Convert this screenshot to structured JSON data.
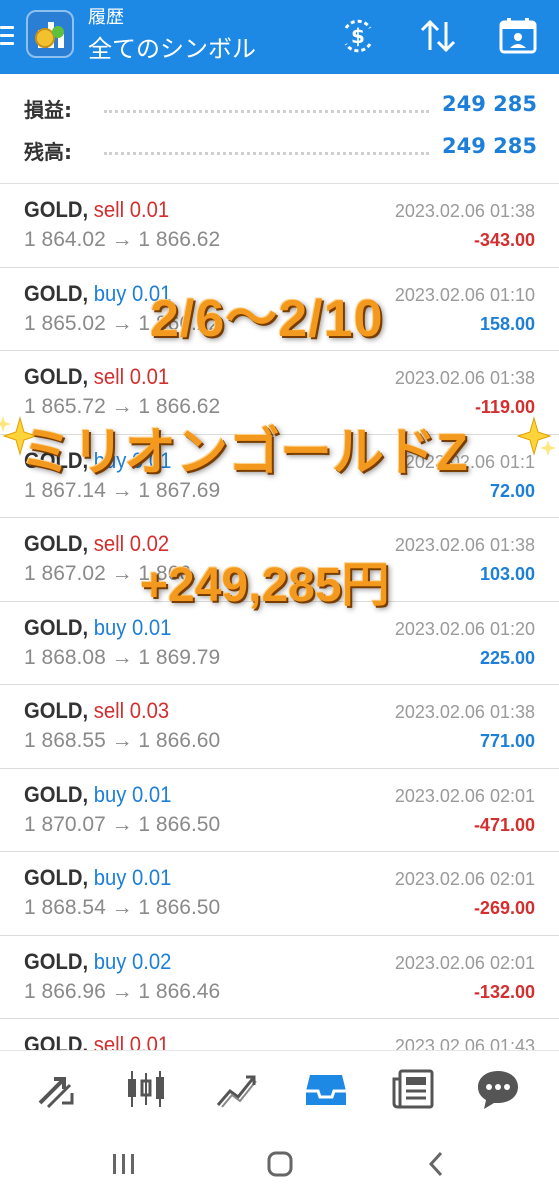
{
  "header": {
    "subtitle": "履歴",
    "title": "全てのシンボル",
    "icons": [
      "menu-icon",
      "app-logo",
      "currency-exchange-icon",
      "sort-icon",
      "calendar-icon"
    ]
  },
  "summary": {
    "profit_label": "損益:",
    "profit_value": "249 285",
    "balance_label": "残高:",
    "balance_value": "249 285"
  },
  "trades": [
    {
      "symbol": "GOLD,",
      "side": "sell 0.01",
      "type": "sell",
      "prices": "1 864.02 → 1 866.62",
      "time": "2023.02.06 01:38",
      "profit": "-343.00",
      "profit_sign": "neg"
    },
    {
      "symbol": "GOLD,",
      "side": "buy 0.01",
      "type": "buy",
      "prices": "1 865.02 → 1 866.22",
      "time": "2023.02.06 01:10",
      "profit": "158.00",
      "profit_sign": "pos"
    },
    {
      "symbol": "GOLD,",
      "side": "sell 0.01",
      "type": "sell",
      "prices": "1 865.72 → 1 866.62",
      "time": "2023.02.06 01:38",
      "profit": "-119.00",
      "profit_sign": "neg"
    },
    {
      "symbol": "GOLD,",
      "side": "buy 0.01",
      "type": "buy",
      "prices": "1 867.14 → 1 867.69",
      "time": "2023.02.06 01:1",
      "profit": "72.00",
      "profit_sign": "pos"
    },
    {
      "symbol": "GOLD,",
      "side": "sell 0.02",
      "type": "sell",
      "prices": "1 867.02 → 1 866.",
      "time": "2023.02.06 01:38",
      "profit": "103.00",
      "profit_sign": "pos"
    },
    {
      "symbol": "GOLD,",
      "side": "buy 0.01",
      "type": "buy",
      "prices": "1 868.08 → 1 869.79",
      "time": "2023.02.06 01:20",
      "profit": "225.00",
      "profit_sign": "pos"
    },
    {
      "symbol": "GOLD,",
      "side": "sell 0.03",
      "type": "sell",
      "prices": "1 868.55 → 1 866.60",
      "time": "2023.02.06 01:38",
      "profit": "771.00",
      "profit_sign": "pos"
    },
    {
      "symbol": "GOLD,",
      "side": "buy 0.01",
      "type": "buy",
      "prices": "1 870.07 → 1 866.50",
      "time": "2023.02.06 02:01",
      "profit": "-471.00",
      "profit_sign": "neg"
    },
    {
      "symbol": "GOLD,",
      "side": "buy 0.01",
      "type": "buy",
      "prices": "1 868.54 → 1 866.50",
      "time": "2023.02.06 02:01",
      "profit": "-269.00",
      "profit_sign": "neg"
    },
    {
      "symbol": "GOLD,",
      "side": "buy 0.02",
      "type": "buy",
      "prices": "1 866.96 → 1 866.46",
      "time": "2023.02.06 02:01",
      "profit": "-132.00",
      "profit_sign": "neg"
    },
    {
      "symbol": "GOLD,",
      "side": "sell 0.01",
      "type": "sell",
      "prices": "",
      "time": "2023.02.06 01:43",
      "profit": "",
      "profit_sign": "neg"
    }
  ],
  "overlay": {
    "dates": "2/6〜2/10",
    "name": "ミリオンゴールドZ",
    "amount": "+249,285円"
  },
  "bottom_nav": {
    "items": [
      "trade-icon",
      "chart-candles-icon",
      "trend-line-icon",
      "history-inbox-icon",
      "news-icon",
      "chat-icon"
    ],
    "active_color": "#1e88e5",
    "inactive_color": "#555555"
  },
  "colors": {
    "header_bg": "#1e88e5",
    "sell": "#d32f2f",
    "buy": "#1e7fd8",
    "overlay_text": "#f39a1e"
  }
}
